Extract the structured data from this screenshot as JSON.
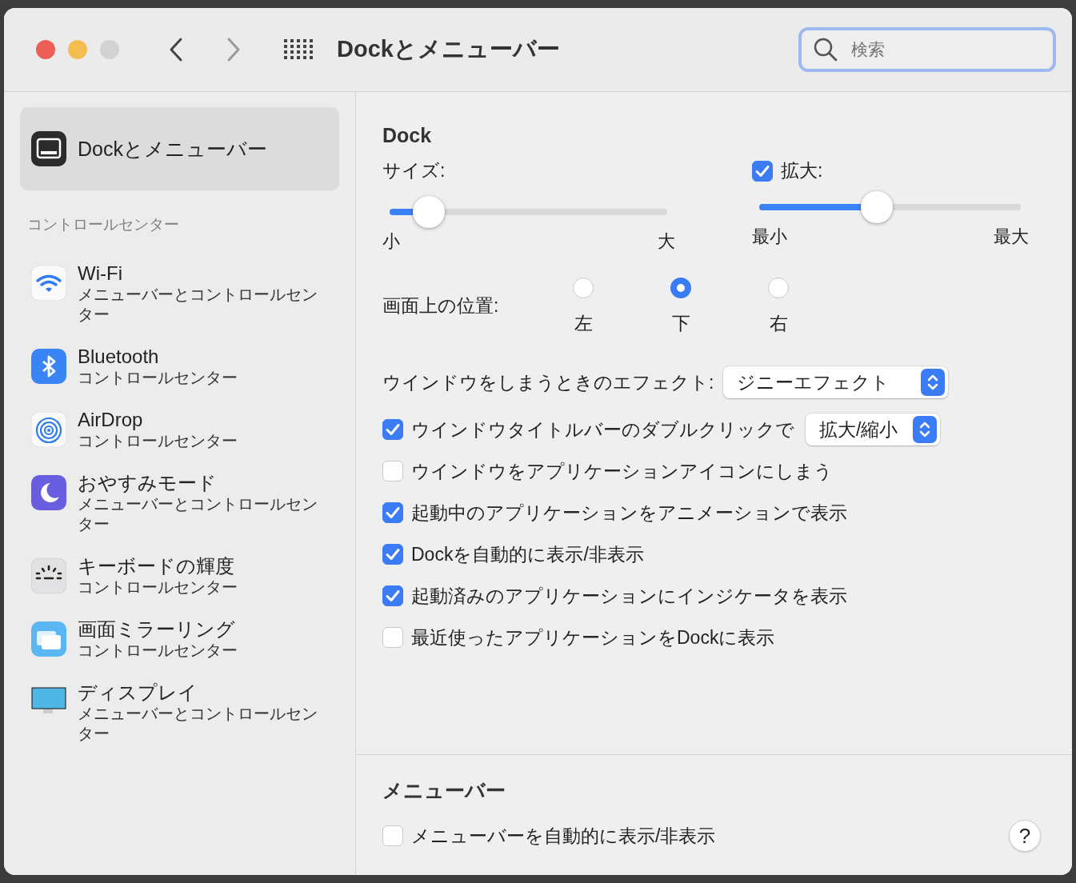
{
  "window": {
    "title": "Dockとメニューバー"
  },
  "search": {
    "placeholder": "検索"
  },
  "sidebar": {
    "items": [
      {
        "title": "Dockとメニューバー",
        "selected": true
      }
    ],
    "sections": [
      {
        "label": "コントロールセンター",
        "items": [
          {
            "title": "Wi-Fi",
            "subtitle": "メニューバーとコントロールセンター",
            "selected": false
          },
          {
            "title": "Bluetooth",
            "subtitle": "コントロールセンター",
            "selected": false
          },
          {
            "title": "AirDrop",
            "subtitle": "コントロールセンター",
            "selected": false
          },
          {
            "title": "おやすみモード",
            "subtitle": "メニューバーとコントロールセンター",
            "selected": false
          },
          {
            "title": "キーボードの輝度",
            "subtitle": "コントロールセンター",
            "selected": false
          },
          {
            "title": "画面ミラーリング",
            "subtitle": "コントロールセンター",
            "selected": false
          },
          {
            "title": "ディスプレイ",
            "subtitle": "メニューバーとコントロールセンター",
            "selected": false
          }
        ]
      }
    ]
  },
  "dock": {
    "heading": "Dock",
    "size": {
      "label": "サイズ:",
      "level": 0.14,
      "min_label": "小",
      "max_label": "大"
    },
    "magnification": {
      "label": "拡大:",
      "checked": true,
      "level": 0.45,
      "min_label": "最小",
      "max_label": "最大"
    },
    "position": {
      "label": "画面上の位置:",
      "options": [
        {
          "label": "左",
          "selected": false
        },
        {
          "label": "下",
          "selected": true
        },
        {
          "label": "右",
          "selected": false
        }
      ]
    },
    "minimize_effect": {
      "label": "ウインドウをしまうときのエフェクト:",
      "value": "ジニーエフェクト"
    },
    "options": [
      {
        "label": "ウインドウタイトルバーのダブルクリックで",
        "checked": true,
        "popup": "拡大/縮小"
      },
      {
        "label": "ウインドウをアプリケーションアイコンにしまう",
        "checked": false
      },
      {
        "label": "起動中のアプリケーションをアニメーションで表示",
        "checked": true
      },
      {
        "label": "Dockを自動的に表示/非表示",
        "checked": true
      },
      {
        "label": "起動済みのアプリケーションにインジケータを表示",
        "checked": true
      },
      {
        "label": "最近使ったアプリケーションをDockに表示",
        "checked": false
      }
    ]
  },
  "menubar": {
    "heading": "メニューバー",
    "options": [
      {
        "label": "メニューバーを自動的に表示/非表示",
        "checked": false
      }
    ]
  },
  "help_button": "?"
}
